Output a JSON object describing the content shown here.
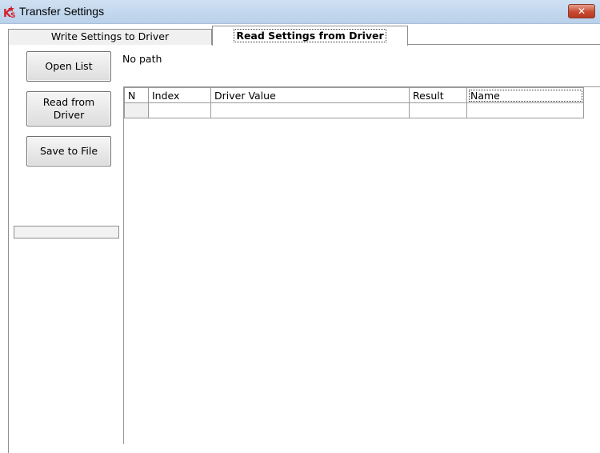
{
  "window": {
    "title": "Transfer Settings",
    "icon": "ks-app-icon",
    "close_label": "✕"
  },
  "tabs": [
    {
      "label": "Write Settings to Driver",
      "active": false
    },
    {
      "label": "Read Settings from Driver",
      "active": true
    }
  ],
  "buttons": {
    "open_list": "Open List",
    "read_from_driver": "Read from\nDriver",
    "save_to_file": "Save to File"
  },
  "path_label": "No path",
  "progress": {
    "value_percent": 0
  },
  "table": {
    "columns": [
      "N",
      "Index",
      "Driver Value",
      "Result",
      "Name"
    ],
    "rows": [
      [
        "",
        "",
        "",
        "",
        ""
      ]
    ]
  },
  "colors": {
    "titlebar": "#c4d9ee",
    "close_button": "#c94a30",
    "icon_red": "#d21f2a"
  }
}
